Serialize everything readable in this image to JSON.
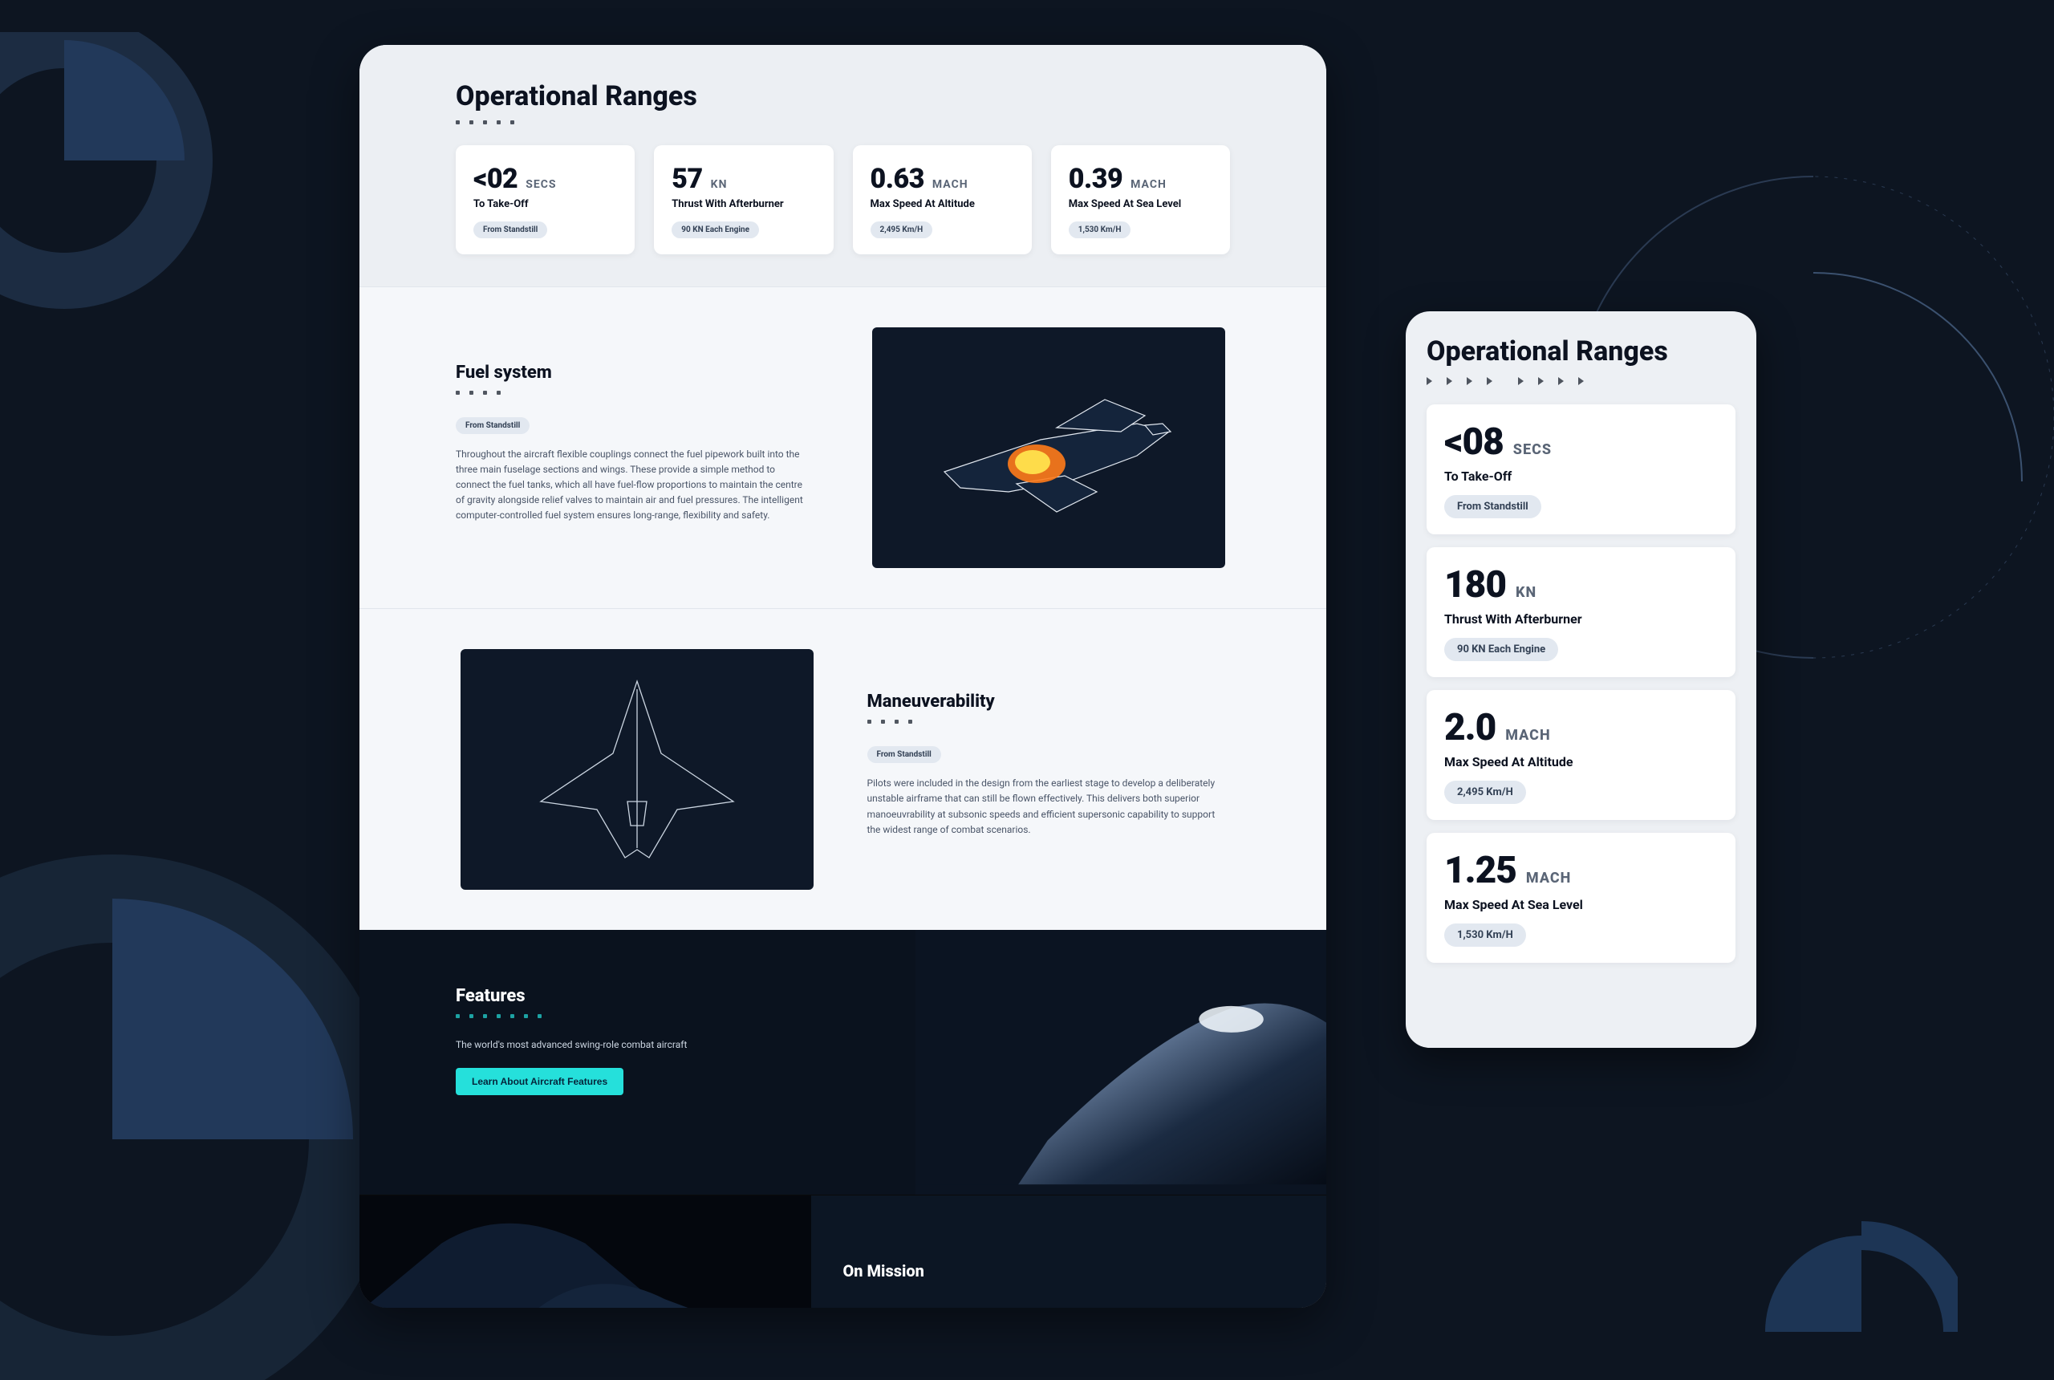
{
  "desktop": {
    "title": "Operational Ranges",
    "cards": [
      {
        "value": "<02",
        "unit": "SECS",
        "label": "To Take-Off",
        "pill": "From Standstill"
      },
      {
        "value": "57",
        "unit": "KN",
        "label": "Thrust With Afterburner",
        "pill": "90 KN Each Engine"
      },
      {
        "value": "0.63",
        "unit": "MACH",
        "label": "Max Speed At Altitude",
        "pill": "2,495 Km/H"
      },
      {
        "value": "0.39",
        "unit": "MACH",
        "label": "Max Speed At Sea Level",
        "pill": "1,530 Km/H"
      }
    ],
    "fuel": {
      "title": "Fuel system",
      "pill": "From Standstill",
      "body": "Throughout the aircraft flexible couplings connect the fuel pipework built into the three main fuselage sections and wings. These provide a simple method to connect the fuel tanks, which all have fuel-flow proportions to maintain the centre of gravity alongside relief valves to maintain air and fuel pressures. The intelligent computer-controlled fuel system ensures long-range, flexibility and safety."
    },
    "maneuver": {
      "title": "Maneuverability",
      "pill": "From Standstill",
      "body": "Pilots were included in the design from the earliest stage to develop a deliberately unstable airframe that can still be flown effectively. This delivers both superior manoeuvrability at subsonic speeds and efficient supersonic capability to support the widest range of combat scenarios."
    },
    "features": {
      "title": "Features",
      "subtitle": "The world's most advanced swing-role combat aircraft",
      "button": "Learn About Aircraft Features"
    },
    "mission": {
      "title": "On Mission"
    }
  },
  "mobile": {
    "title": "Operational Ranges",
    "cards": [
      {
        "value": "<08",
        "unit": "SECS",
        "label": "To Take-Off",
        "pill": "From Standstill"
      },
      {
        "value": "180",
        "unit": "KN",
        "label": "Thrust With Afterburner",
        "pill": "90 KN Each Engine"
      },
      {
        "value": "2.0",
        "unit": "MACH",
        "label": "Max Speed At Altitude",
        "pill": "2,495 Km/H"
      },
      {
        "value": "1.25",
        "unit": "MACH",
        "label": "Max Speed At Sea Level",
        "pill": "1,530 Km/H"
      }
    ]
  }
}
